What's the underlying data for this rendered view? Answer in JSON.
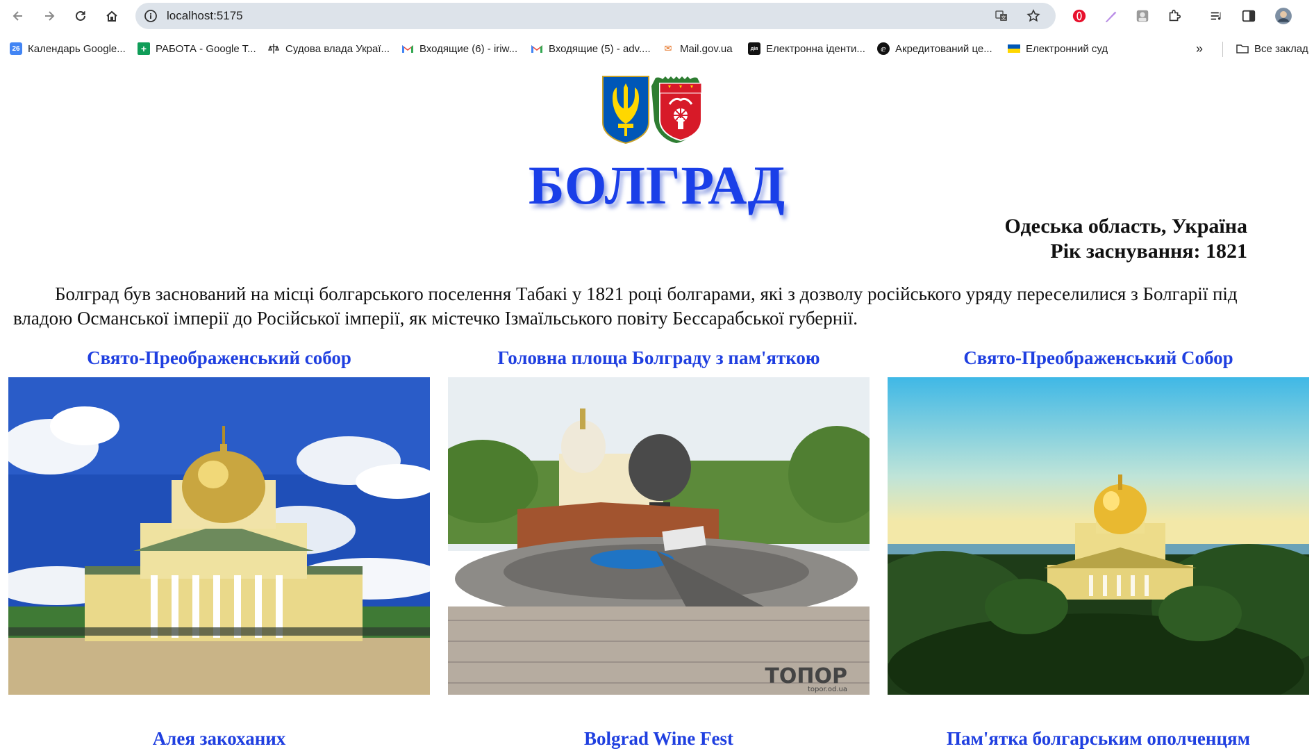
{
  "browser": {
    "url": "localhost:5175",
    "bookmarks": [
      {
        "label": "Календарь Google...",
        "icon": "google-calendar-icon"
      },
      {
        "label": "РАБОТА - Google T...",
        "icon": "google-sheets-icon"
      },
      {
        "label": "Судова влада Украї...",
        "icon": "court-icon"
      },
      {
        "label": "Входящие (6) - iriw...",
        "icon": "gmail-icon"
      },
      {
        "label": "Входящие (5) - adv....",
        "icon": "gmail-icon"
      },
      {
        "label": "Mail.gov.ua",
        "icon": "mailgov-icon"
      },
      {
        "label": "Електронна іденти...",
        "icon": "diia-icon"
      },
      {
        "label": "Акредитований це...",
        "icon": "accredited-center-icon"
      },
      {
        "label": "Електронний суд",
        "icon": "ukraine-flag-icon"
      }
    ],
    "more_bookmarks": "»",
    "all_bookmarks": "Все заклад"
  },
  "page": {
    "title": "БОЛГРАД",
    "region": "Одеська область, Україна",
    "founded": "Рік заснування: 1821",
    "intro": "Болград був заснований на місці болгарського поселення Табакі у 1821 році болгарами, які з дозволу російського уряду переселилися з Болгарії під владою Османської імперії до Російської імперії, як містечко Ізмаїльського повіту Бессарабської губернії.",
    "cards": [
      {
        "title": "Свято-Преображенський собор"
      },
      {
        "title": "Головна площа Болграду з пам'яткою"
      },
      {
        "title": "Свято-Преображенський Собор"
      },
      {
        "title": "Алея закоханих"
      },
      {
        "title": "Bolgrad Wine Fest"
      },
      {
        "title": "Пам'ятка болгарським ополченцям"
      }
    ],
    "watermark_text": "ТОПОР",
    "watermark_url": "topor.od.ua"
  },
  "colors": {
    "title_blue": "#1a3fe8",
    "card_title_blue": "#1f3fe0",
    "omnibox_bg": "#dde3ea"
  }
}
